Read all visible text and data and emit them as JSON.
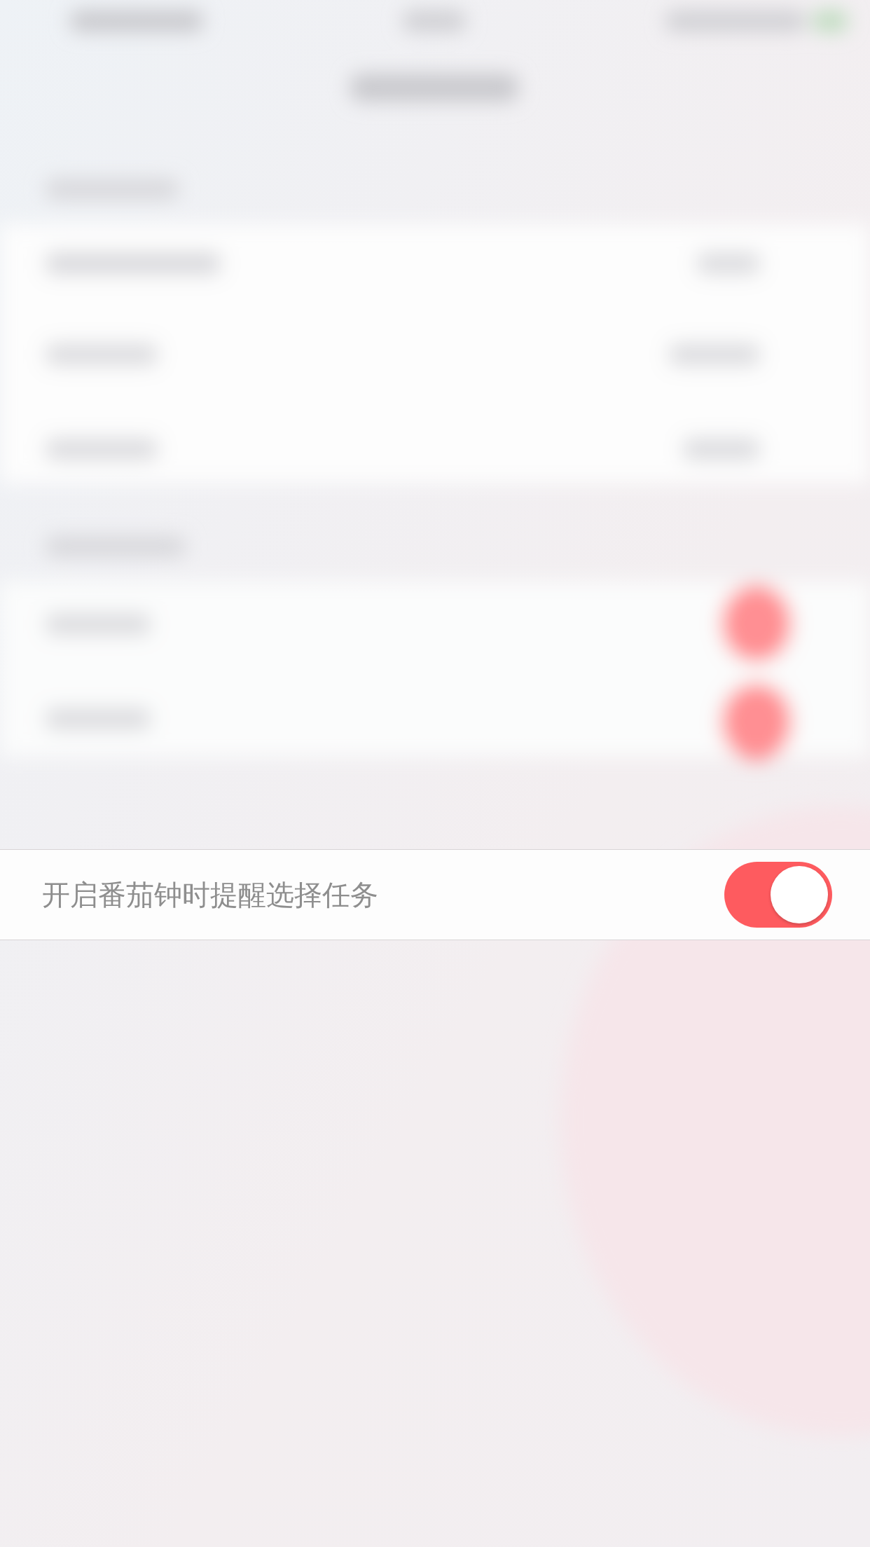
{
  "setting_row": {
    "label": "开启番茄钟时提醒选择任务",
    "on": true
  }
}
